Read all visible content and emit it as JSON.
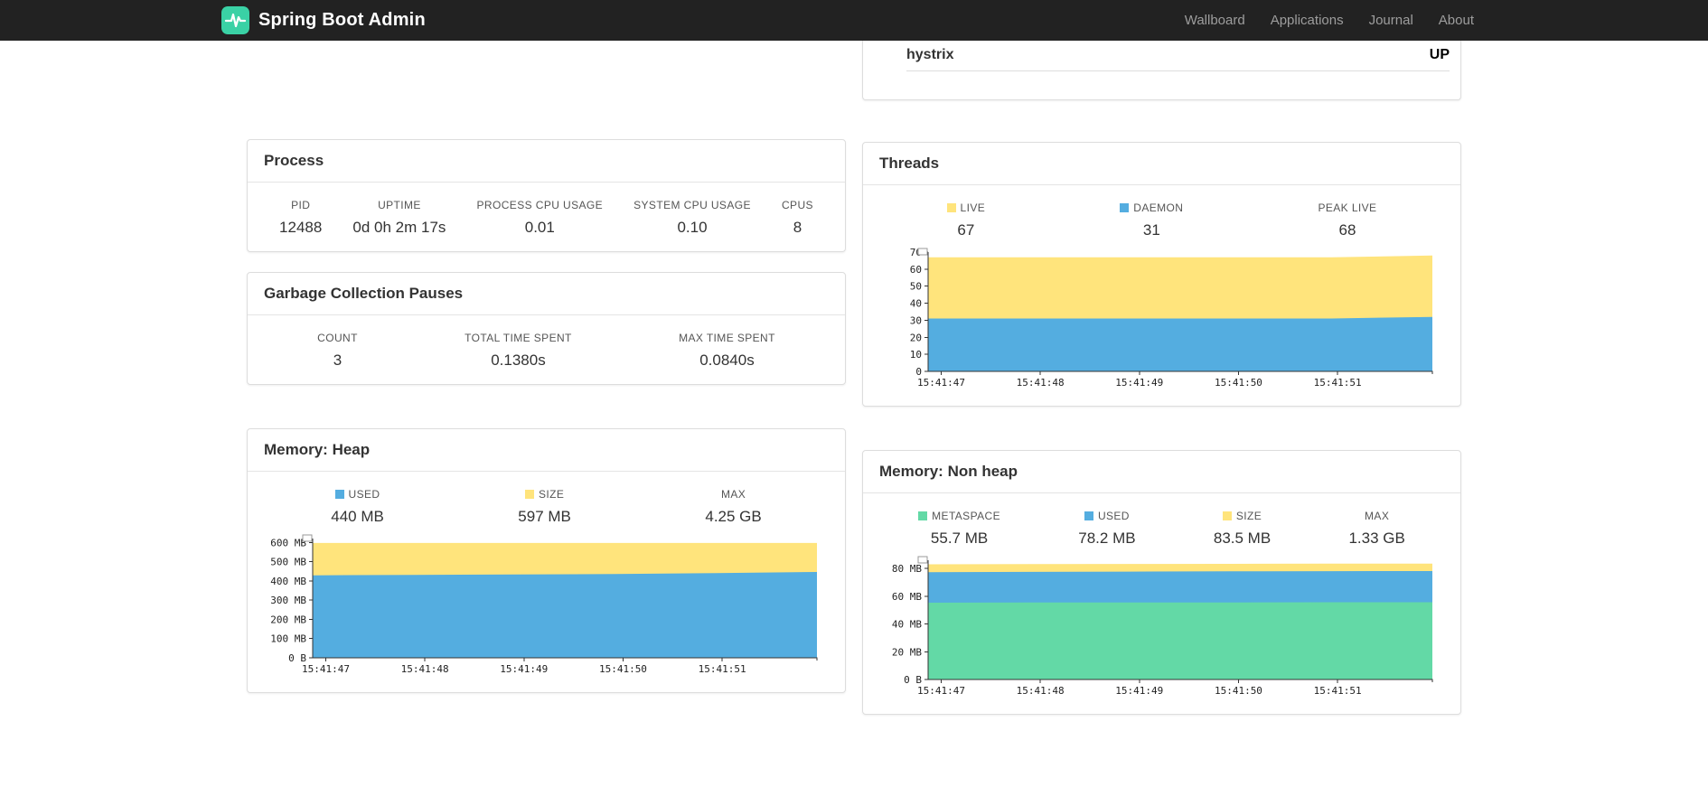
{
  "navbar": {
    "brand": "Spring Boot Admin",
    "links": [
      {
        "label": "Wallboard"
      },
      {
        "label": "Applications"
      },
      {
        "label": "Journal"
      },
      {
        "label": "About"
      }
    ]
  },
  "colors": {
    "brand_green": "#3ad1a5",
    "status_up": "#44cc11",
    "blue": "#54ade0",
    "yellow": "#ffe47c",
    "green": "#63d9a6",
    "navbar_bg": "#222222"
  },
  "application_row": {
    "name": "hystrix",
    "status": "UP"
  },
  "cards": {
    "process": {
      "title": "Process",
      "stats": [
        {
          "label": "PID",
          "value": "12488"
        },
        {
          "label": "UPTIME",
          "value": "0d 0h 2m 17s"
        },
        {
          "label": "PROCESS CPU USAGE",
          "value": "0.01"
        },
        {
          "label": "SYSTEM CPU USAGE",
          "value": "0.10"
        },
        {
          "label": "CPUS",
          "value": "8"
        }
      ]
    },
    "gc": {
      "title": "Garbage Collection Pauses",
      "stats": [
        {
          "label": "COUNT",
          "value": "3"
        },
        {
          "label": "TOTAL TIME SPENT",
          "value": "0.1380s"
        },
        {
          "label": "MAX TIME SPENT",
          "value": "0.0840s"
        }
      ]
    },
    "threads": {
      "title": "Threads",
      "stats": [
        {
          "label": "LIVE",
          "value": "67",
          "color": "yellow"
        },
        {
          "label": "DAEMON",
          "value": "31",
          "color": "blue"
        },
        {
          "label": "PEAK LIVE",
          "value": "68"
        }
      ]
    },
    "heap": {
      "title": "Memory: Heap",
      "stats": [
        {
          "label": "USED",
          "value": "440 MB",
          "color": "blue"
        },
        {
          "label": "SIZE",
          "value": "597 MB",
          "color": "yellow"
        },
        {
          "label": "MAX",
          "value": "4.25 GB"
        }
      ]
    },
    "nonheap": {
      "title": "Memory: Non heap",
      "stats": [
        {
          "label": "METASPACE",
          "value": "55.7 MB",
          "color": "green"
        },
        {
          "label": "USED",
          "value": "78.2 MB",
          "color": "blue"
        },
        {
          "label": "SIZE",
          "value": "83.5 MB",
          "color": "yellow"
        },
        {
          "label": "MAX",
          "value": "1.33 GB"
        }
      ]
    }
  },
  "chart_data": {
    "threads": {
      "type": "area",
      "ylim": [
        0,
        70
      ],
      "yticks": [
        {
          "v": 0,
          "label": "0"
        },
        {
          "v": 10,
          "label": "10"
        },
        {
          "v": 20,
          "label": "20"
        },
        {
          "v": 30,
          "label": "30"
        },
        {
          "v": 40,
          "label": "40"
        },
        {
          "v": 50,
          "label": "50"
        },
        {
          "v": 60,
          "label": "60"
        },
        {
          "v": 70,
          "label": "70"
        }
      ],
      "xticks": [
        "15:41:47",
        "15:41:48",
        "15:41:49",
        "15:41:50",
        "15:41:51"
      ],
      "series": [
        {
          "name": "live",
          "color": "yellow",
          "values": [
            67,
            67,
            67,
            67,
            67,
            68
          ]
        },
        {
          "name": "daemon",
          "color": "blue",
          "values": [
            31,
            31,
            31,
            31,
            31,
            32
          ]
        }
      ]
    },
    "heap": {
      "type": "area",
      "unit": "MB",
      "ylim": [
        0,
        620
      ],
      "yticks": [
        {
          "v": 0,
          "label": "0 B"
        },
        {
          "v": 100,
          "label": "100 MB"
        },
        {
          "v": 200,
          "label": "200 MB"
        },
        {
          "v": 300,
          "label": "300 MB"
        },
        {
          "v": 400,
          "label": "400 MB"
        },
        {
          "v": 500,
          "label": "500 MB"
        },
        {
          "v": 600,
          "label": "600 MB"
        }
      ],
      "xticks": [
        "15:41:47",
        "15:41:48",
        "15:41:49",
        "15:41:50",
        "15:41:51"
      ],
      "series": [
        {
          "name": "size",
          "color": "yellow",
          "values": [
            597,
            597,
            597,
            597,
            597,
            597
          ]
        },
        {
          "name": "used",
          "color": "blue",
          "values": [
            429,
            431,
            433,
            436,
            440,
            446
          ]
        }
      ]
    },
    "nonheap": {
      "type": "area",
      "unit": "MB",
      "ylim": [
        0,
        86
      ],
      "yticks": [
        {
          "v": 0,
          "label": "0 B"
        },
        {
          "v": 20,
          "label": "20 MB"
        },
        {
          "v": 40,
          "label": "40 MB"
        },
        {
          "v": 60,
          "label": "60 MB"
        },
        {
          "v": 80,
          "label": "80 MB"
        }
      ],
      "xticks": [
        "15:41:47",
        "15:41:48",
        "15:41:49",
        "15:41:50",
        "15:41:51"
      ],
      "series": [
        {
          "name": "size",
          "color": "yellow",
          "values": [
            83.1,
            83.2,
            83.3,
            83.4,
            83.5,
            83.5
          ]
        },
        {
          "name": "used",
          "color": "blue",
          "values": [
            77.4,
            77.6,
            77.8,
            78.0,
            78.1,
            78.2
          ]
        },
        {
          "name": "metaspace",
          "color": "green",
          "values": [
            55.4,
            55.5,
            55.6,
            55.6,
            55.7,
            55.7
          ]
        }
      ]
    }
  }
}
